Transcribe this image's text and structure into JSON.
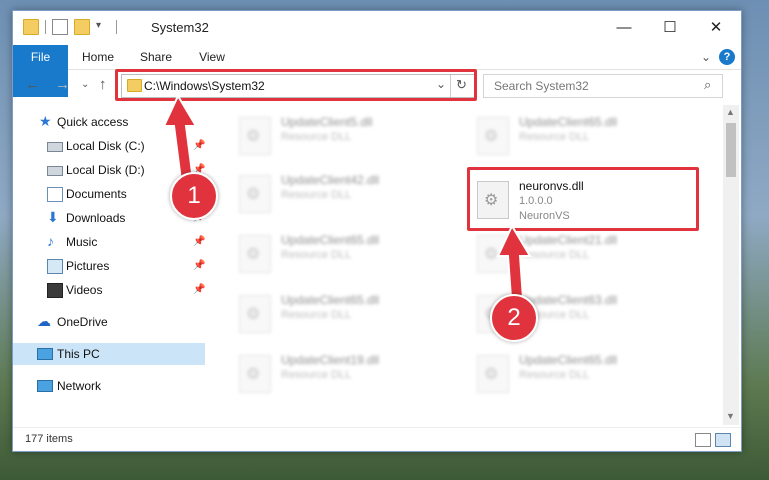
{
  "window": {
    "title": "System32",
    "controls": {
      "minimize": "—",
      "maximize": "☐",
      "close": "✕"
    }
  },
  "ribbon": {
    "tabs": [
      "File",
      "Home",
      "Share",
      "View"
    ],
    "expand": "⌄",
    "help": "?"
  },
  "address": {
    "path": "C:\\Windows\\System32",
    "dropdown": "⌄",
    "refresh": "↻",
    "back": "←",
    "forward": "→",
    "recent": "⌄",
    "up": "↑"
  },
  "search": {
    "placeholder": "Search System32",
    "icon": "⌕"
  },
  "nav": {
    "items": [
      {
        "label": "Quick access",
        "icon": "star-icon",
        "pinned": false
      },
      {
        "label": "Local Disk (C:)",
        "icon": "drive-icon",
        "pinned": true
      },
      {
        "label": "Local Disk (D:)",
        "icon": "drive-icon",
        "pinned": true
      },
      {
        "label": "Documents",
        "icon": "documents-icon",
        "pinned": true
      },
      {
        "label": "Downloads",
        "icon": "download-icon",
        "pinned": true
      },
      {
        "label": "Music",
        "icon": "music-icon",
        "pinned": true
      },
      {
        "label": "Pictures",
        "icon": "pictures-icon",
        "pinned": true
      },
      {
        "label": "Videos",
        "icon": "videos-icon",
        "pinned": true
      },
      {
        "label": "OneDrive",
        "icon": "cloud-icon",
        "pinned": false
      },
      {
        "label": "This PC",
        "icon": "computer-icon",
        "pinned": false,
        "selected": true
      },
      {
        "label": "Network",
        "icon": "network-icon",
        "pinned": false
      }
    ],
    "pin_glyph": "📌"
  },
  "files": {
    "left": [
      {
        "name": "UpdateClient5.dll",
        "desc": "Resource DLL"
      },
      {
        "name": "UpdateClient42.dll",
        "desc": "Resource DLL"
      },
      {
        "name": "UpdateClient65.dll",
        "desc": "Resource DLL"
      },
      {
        "name": "UpdateClient65.dll",
        "desc": "Resource DLL"
      },
      {
        "name": "UpdateClient19.dll",
        "desc": "Resource DLL"
      }
    ],
    "right": [
      {
        "name": "UpdateClient65.dll",
        "desc": "Resource DLL"
      },
      {
        "name": "UpdateClient21.dll",
        "desc": "Resource DLL"
      },
      {
        "name": "UpdateClient63.dll",
        "desc": "Resource DLL"
      },
      {
        "name": "UpdateClient65.dll",
        "desc": "Resource DLL"
      }
    ],
    "highlight": {
      "name": "neuronvs.dll",
      "version": "1.0.0.0",
      "company": "NeuronVS"
    }
  },
  "status": {
    "items": "177 items"
  },
  "annotations": {
    "badge1": "1",
    "badge2": "2",
    "color": "#e0333d"
  }
}
